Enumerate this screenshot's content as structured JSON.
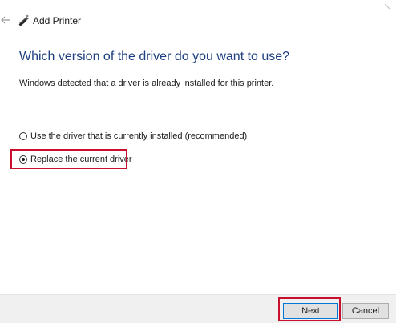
{
  "window": {
    "title": "Add Printer",
    "back_icon": "back-arrow-icon",
    "app_icon": "printer-icon"
  },
  "content": {
    "heading": "Which version of the driver do you want to use?",
    "info": "Windows detected that a driver is already installed for this printer.",
    "options": [
      {
        "label": "Use the driver that is currently installed (recommended)",
        "selected": false
      },
      {
        "label": "Replace the current driver",
        "selected": true
      }
    ]
  },
  "footer": {
    "next_label": "Next",
    "cancel_label": "Cancel"
  },
  "colors": {
    "heading": "#1e3f83",
    "highlight": "#c8102e",
    "footer_bg": "#f0f0f0",
    "focus_border": "#0078d7"
  }
}
